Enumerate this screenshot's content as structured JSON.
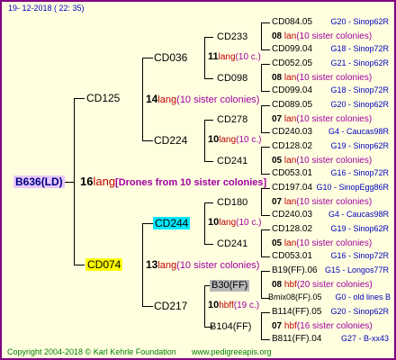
{
  "header": {
    "date": "19-  12-2018  ( 22: 35)"
  },
  "footer": {
    "copyright": "Copyright 2004-2018 © Karl Kehrle Foundation",
    "site": "www.pedigreeapis.org"
  },
  "root": {
    "name": "B636(LD)",
    "num": "16",
    "lang": "lang",
    "note": "[Drones from 10 sister colonies]"
  },
  "l1_top": {
    "name": "CD125",
    "num": "14",
    "lang": "lang",
    "note": "(10 sister colonies)"
  },
  "l1_bot": {
    "name": "CD074",
    "num": "13",
    "lang": "lang",
    "note": "(10 sister colonies)"
  },
  "l2": {
    "a": {
      "name": "CD036",
      "num": "11",
      "lang": "lang",
      "note": "(10 c.)"
    },
    "b": {
      "name": "CD224",
      "num": "10",
      "lang": "lang",
      "note": "(10 c.)"
    },
    "c": {
      "name": "CD244",
      "num": "10",
      "lang": "lang",
      "note": "(10 c.)"
    },
    "d": {
      "name": "CD217",
      "num": "10",
      "lang": "hbff",
      "note": "(19 c.)"
    }
  },
  "l3": {
    "a": {
      "name": "CD233",
      "num": "08",
      "lang": "lan",
      "note": "(10 sister colonies)"
    },
    "b": {
      "name": "CD098",
      "num": "08",
      "lang": "lan",
      "note": "(10 sister colonies)"
    },
    "c": {
      "name": "CD278",
      "num": "07",
      "lang": "lan",
      "note": "(10 sister colonies)"
    },
    "d": {
      "name": "CD241",
      "num": "05",
      "lang": "lan",
      "note": "(10 sister colonies)"
    },
    "e": {
      "name": "CD180",
      "num": "07",
      "lang": "lan",
      "note": "(10 sister colonies)"
    },
    "f": {
      "name": "CD241",
      "num": "05",
      "lang": "lan",
      "note": "(10 sister colonies)"
    },
    "g": {
      "name": "B30(FF)",
      "num": "08",
      "lang": "hbf",
      "note": "(20 sister colonies)"
    },
    "h": {
      "name": "B104(FF)",
      "num": "07",
      "lang": "hbf",
      "note": "(16 sister colonies)"
    }
  },
  "l4": [
    {
      "name": "CD084.05",
      "src": "G20 - Sinop62R"
    },
    {
      "name": "CD099.04",
      "src": "G18 - Sinop72R"
    },
    {
      "name": "CD052.05",
      "src": "G21 - Sinop62R"
    },
    {
      "name": "CD099.04",
      "src": "G18 - Sinop72R"
    },
    {
      "name": "CD089.05",
      "src": "G20 - Sinop62R"
    },
    {
      "name": "CD240.03",
      "src": "G4 - Caucas98R"
    },
    {
      "name": "CD128.02",
      "src": "G19 - Sinop62R"
    },
    {
      "name": "CD053.01",
      "src": "G16 - Sinop72R"
    },
    {
      "name": "CD197.04",
      "src": "G10 - SinopEgg86R"
    },
    {
      "name": "CD240.03",
      "src": "G4 - Caucas98R"
    },
    {
      "name": "CD128.02",
      "src": "G19 - Sinop62R"
    },
    {
      "name": "CD053.01",
      "src": "G16 - Sinop72R"
    },
    {
      "name": "B19(FF).06",
      "src": "G15 - Longos77R"
    },
    {
      "name": "Bmix08(FF).05",
      "src": "G0 - old lines B"
    },
    {
      "name": "B114(FF).05",
      "src": "G20 - Sinop62R"
    },
    {
      "name": "B811(FF).04",
      "src": "G27 - B-xx43"
    }
  ]
}
